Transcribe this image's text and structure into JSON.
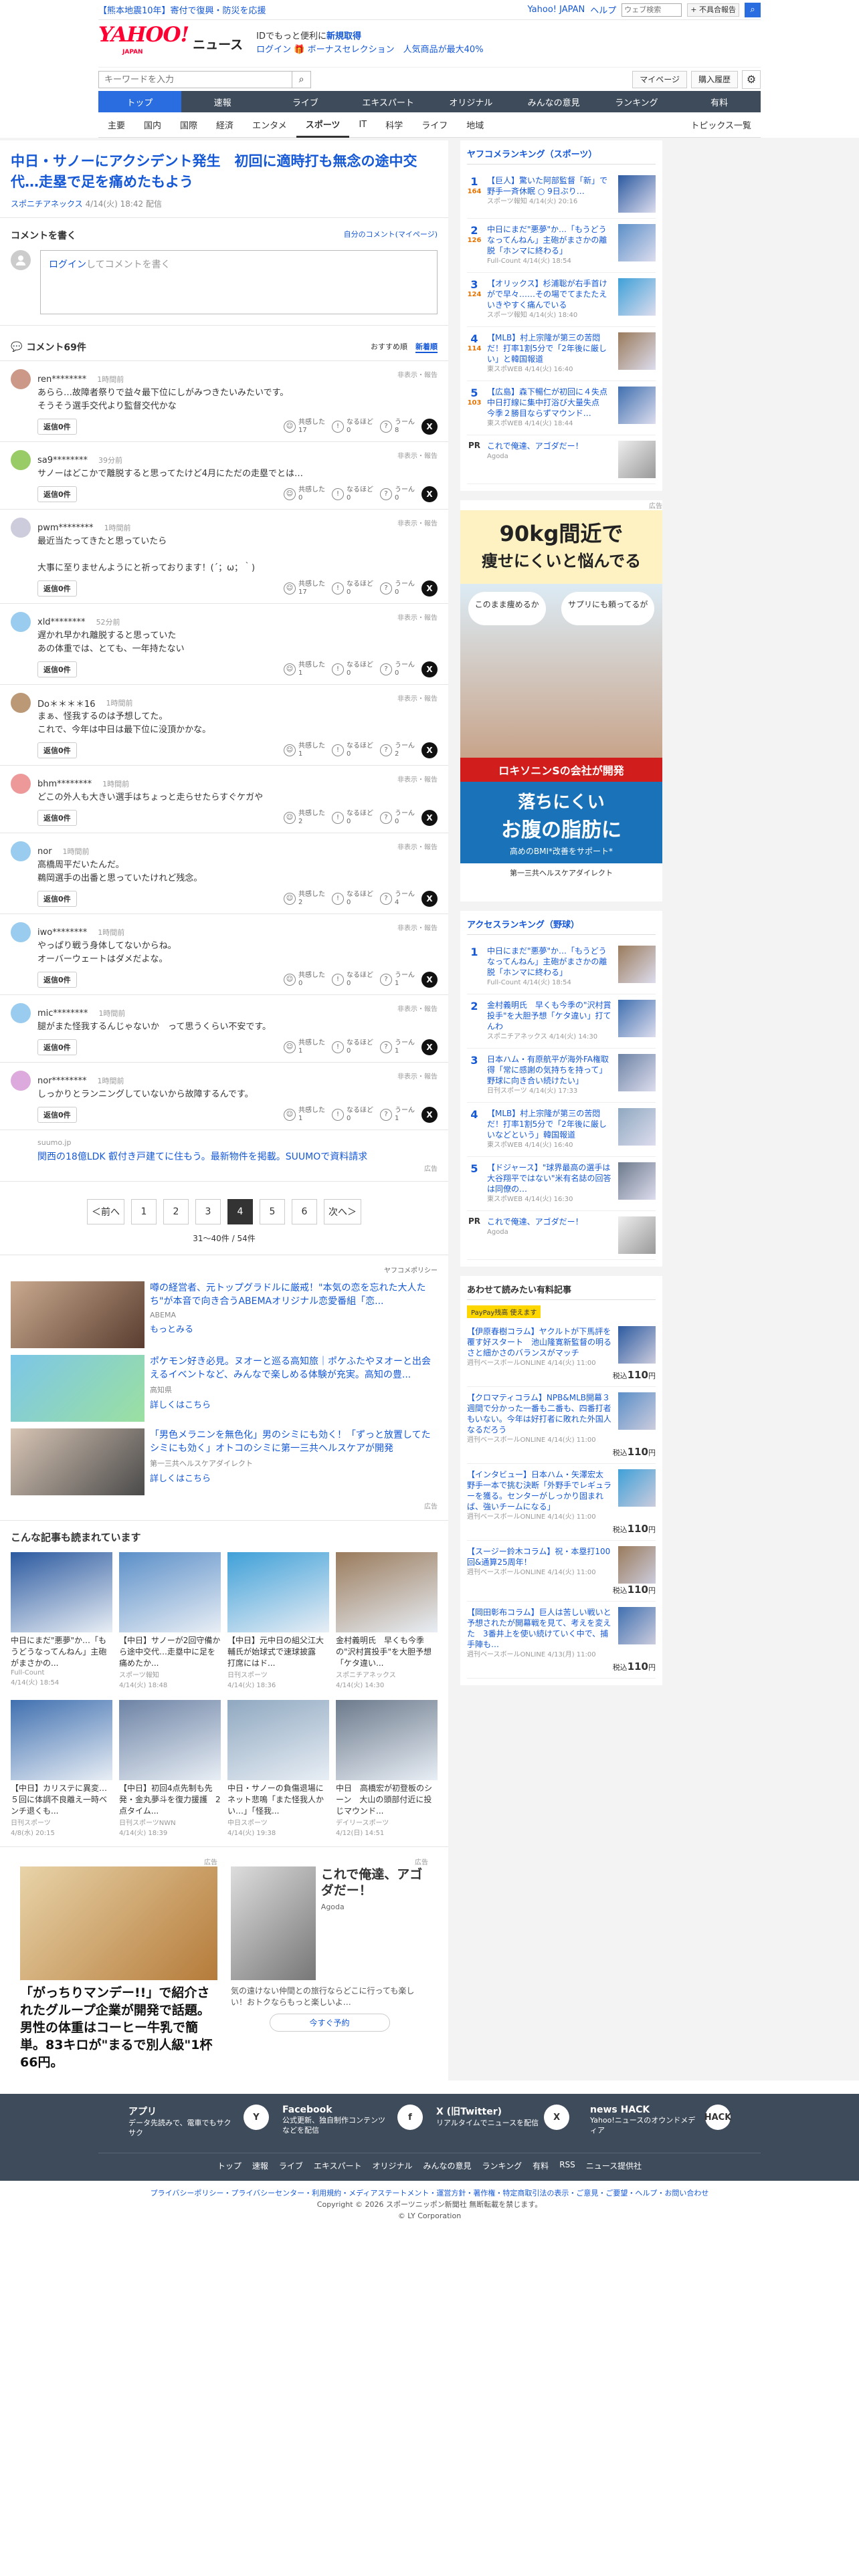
{
  "topbar": {
    "promo": "【熊本地震10年】寄付で復興・防災を応援",
    "links": [
      "Yahoo! JAPAN",
      "ヘルプ"
    ],
    "search_placeholder": "ウェブ検索",
    "request_btn": "+ 不具合報告"
  },
  "header": {
    "logo": "YAHOO!",
    "logo_sub": "JAPAN",
    "section": "ニュース",
    "line1_prefix": "IDでもっと便利に",
    "line1_link": "新規取得",
    "line2_login": "ログイン",
    "line2_rest": "🎁 ボーナスセレクション　人気商品が最大40%"
  },
  "search": {
    "placeholder": "キーワードを入力",
    "mypage": "マイページ",
    "purchase": "購入履歴"
  },
  "mainnav": [
    "トップ",
    "速報",
    "ライブ",
    "エキスパート",
    "オリジナル",
    "みんなの意見",
    "ランキング",
    "有料"
  ],
  "subnav": [
    "主要",
    "国内",
    "国際",
    "経済",
    "エンタメ",
    "スポーツ",
    "IT",
    "科学",
    "ライフ",
    "地域"
  ],
  "subnav_right": "トピックス一覧",
  "article": {
    "title": "中日・サノーにアクシデント発生　初回に適時打も無念の途中交代…走塁で足を痛めたもよう",
    "source": "スポニチアネックス",
    "date": "4/14(火) 18:42 配信"
  },
  "composer": {
    "title": "コメントを書く",
    "mine": "自分のコメント(マイページ)",
    "login": "ログイン",
    "placeholder": "してコメントを書く"
  },
  "comments_head": {
    "title": "コメント69件",
    "sort_recommended": "おすすめ順",
    "sort_new": "新着順"
  },
  "reaction_labels": [
    "共感した",
    "なるほど",
    "うーん"
  ],
  "report_label": "非表示・報告",
  "reply_label": "返信0件",
  "comments": [
    {
      "name": "ren********",
      "time": "1時間前",
      "body": "あらら…故障者祭りで益々最下位にしがみつきたいみたいです。\nそうそう選手交代より監督交代かな",
      "r": [
        "17",
        "0",
        "8"
      ],
      "color": "#c98"
    },
    {
      "name": "sa9********",
      "time": "39分前",
      "body": "サノーはどこかで離脱すると思ってたけど4月にただの走塁でとは…",
      "r": [
        "0",
        "0",
        "0"
      ],
      "color": "#9c6"
    },
    {
      "name": "pwm********",
      "time": "1時間前",
      "body": "最近当たってきたと思っていたら\n\n大事に至りませんようにと祈っております！(´；ω；｀)",
      "r": [
        "17",
        "0",
        "0"
      ],
      "color": "#ccd"
    },
    {
      "name": "xld********",
      "time": "52分前",
      "body": "遅かれ早かれ離脱すると思っていた\nあの体重では、とても、一年持たない",
      "r": [
        "1",
        "0",
        "0"
      ],
      "color": "#9ce"
    },
    {
      "name": "Do＊＊＊＊16",
      "time": "1時間前",
      "body": "まぁ、怪我するのは予想してた。\nこれで、今年は中日は最下位に没頂かかな。",
      "r": [
        "1",
        "0",
        "2"
      ],
      "color": "#b97"
    },
    {
      "name": "bhm********",
      "time": "1時間前",
      "body": "どこの外人も大きい選手はちょっと走らせたらすぐケガや",
      "r": [
        "2",
        "0",
        "0"
      ],
      "color": "#e99"
    },
    {
      "name": "nor",
      "time": "1時間前",
      "body": "高橋周平だいたんだ。\n鵜岡選手の出番と思っていたけれど残念。",
      "r": [
        "2",
        "0",
        "4"
      ],
      "color": "#9ce"
    },
    {
      "name": "iwo********",
      "time": "1時間前",
      "body": "やっぱり戦う身体してないからね。\nオーバーウェートはダメだよな。",
      "r": [
        "0",
        "0",
        "1"
      ],
      "color": "#9ce"
    },
    {
      "name": "mic********",
      "time": "1時間前",
      "body": "腿がまた怪我するんじゃないか　って思うくらい不安です。",
      "r": [
        "1",
        "0",
        "1"
      ],
      "color": "#9ce"
    },
    {
      "name": "nor********",
      "time": "1時間前",
      "body": "しっかりとランニングしていないから故障するんです。",
      "r": [
        "1",
        "0",
        "1"
      ],
      "color": "#dad"
    }
  ],
  "ad_comment": {
    "source": "suumo.jp",
    "title": "関西の18億LDK 叡付き戸建てに住もう。最新物件を掲載。SUUMOで資料請求",
    "label": "広告"
  },
  "pager": {
    "prev": "＜前へ",
    "next": "次へ＞",
    "pages": [
      "1",
      "2",
      "3",
      "4",
      "5",
      "6"
    ],
    "current": "4",
    "count": "31〜40件 / 54件"
  },
  "sponsored": {
    "header": "ヤフコメポリシー",
    "items": [
      {
        "title": "噂の経営者、元トップグラドルに厳戒！\"本気の恋を忘れた大人たち\"が本音で向き合うABEMAオリジナル恋愛番組「恋...",
        "source": "ABEMA",
        "more": "もっとみる"
      },
      {
        "title": "ポケモン好き必見。ヌオーと巡る高知旅｜ポケふたやヌオーと出会えるイベントなど、みんなで楽しめる体験が充実。高知の豊...",
        "source": "高知県",
        "more": "詳しくはこちら"
      },
      {
        "title": "「男色メラニンを無色化」男のシミにも効く！「ずっと放置してたシミにも効く」オトコのシミに第一三共ヘルスケアが開発",
        "source": "第一三共ヘルスケアダイレクト",
        "more": "詳しくはこちら"
      }
    ],
    "footer": "広告"
  },
  "related": {
    "title": "こんな記事も読まれています",
    "items": [
      {
        "title": "中日にまだ\"悪夢\"か…「もうどうなってんねん」主砲がまさかの...",
        "source": "Full-Count",
        "date": "4/14(火) 18:54"
      },
      {
        "title": "【中日】サノーが2回守備から途中交代…走塁中に足を痛めたか...",
        "source": "スポーツ報知",
        "date": "4/14(火) 18:48"
      },
      {
        "title": "【中日】元中日の組父江大輔氏が始球式で速球披露　打席にはド...",
        "source": "日刊スポーツ",
        "date": "4/14(火) 18:36"
      },
      {
        "title": "金村義明氏　早くも今季の\"沢村賞投手\"を大胆予想「ケタ違い...",
        "source": "スポニチアネックス",
        "date": "4/14(火) 14:30"
      },
      {
        "title": "【中日】カリステに異変…５回に体調不良離え一時ベンチ退くも...",
        "source": "日刊スポーツ",
        "date": "4/8(水) 20:15"
      },
      {
        "title": "【中日】初回4点先制も先発・金丸夢斗を復力援護　2点タイム...",
        "source": "日刊スポーツNWN",
        "date": "4/14(火) 18:39"
      },
      {
        "title": "中日・サノーの負傷退場にネット悲鳴「また怪我人かい…」「怪我...",
        "source": "中日スポーツ",
        "date": "4/14(火) 19:38"
      },
      {
        "title": "中日　高橋宏が初登板のシーン　大山の頭部付近に投じマウンド...",
        "source": "デイリースポーツ",
        "date": "4/12(日) 14:51"
      }
    ]
  },
  "bigads": [
    {
      "title": "「がっちりマンデー!!」で紹介されたグループ企業が開発で話題。男性の体重はコーヒー牛乳で簡単。83キロが\"まるで別人級\"1杯66円。",
      "label": "広告"
    },
    {
      "title": "これで俺達、アゴダだー！",
      "source": "Agoda",
      "sub": "気の遠けない仲間との旅行ならどこに行っても楽しい！おトクならもっと楽しいよ…",
      "cta": "今すぐ予約",
      "label": "広告"
    }
  ],
  "sidebar": {
    "rank_title": "ヤフコメランキング（スポーツ）",
    "rank": [
      {
        "n": "1",
        "c": "164",
        "title": "【巨人】驚いた阿部監督「新」で野手一斉休眠 ○ 9日ぶり…",
        "meta": "スポーツ報知 4/14(火) 20:16"
      },
      {
        "n": "2",
        "c": "126",
        "title": "中日にまだ\"悪夢\"か…「もうどうなってんねん」主砲がまさかの離脱「ホンマに終わる」",
        "meta": "Full-Count 4/14(火) 18:54"
      },
      {
        "n": "3",
        "c": "124",
        "title": "【オリックス】杉浦聡が右手首けがで早々……その場でてまたたえいきやすく痛んでいる",
        "meta": "スポーツ報知 4/14(火) 18:40"
      },
      {
        "n": "4",
        "c": "114",
        "title": "【MLB】村上宗隆が第三の苦悶だ！打率1割5分で「2年後に厳しい」と韓国報道",
        "meta": "東スポWEB 4/14(火) 16:40"
      },
      {
        "n": "5",
        "c": "103",
        "title": "【広島】森下暢仁が初回に４失点　中日打線に集中打浴び大量失点　今季２勝目ならずマウンド…",
        "meta": "東スポWEB 4/14(火) 18:44"
      }
    ],
    "rank_pr": {
      "title": "これで俺達、アゴダだー！",
      "source": "Agoda"
    },
    "ad_label": "広告",
    "ad_texts": [
      "90kg間近で",
      "痩せにくいと悩んでる",
      "このまま痩めるか",
      "サプリにも頼ってるが",
      "ロキソニンSの会社が開発",
      "落ちにくい",
      "お腹の脂肪に",
      "高めのBMI*改善をサポート*",
      "第一三共ヘルスケアダイレクト"
    ],
    "access_title": "アクセスランキング（野球）",
    "access": [
      {
        "n": "1",
        "title": "中日にまだ\"悪夢\"か…「もうどうなってんねん」主砲がまさかの離脱「ホンマに終わる」",
        "meta": "Full-Count 4/14(火) 18:54"
      },
      {
        "n": "2",
        "title": "金村義明氏　早くも今季の\"沢村賞投手\"を大胆予想「ケタ違い」打てんわ",
        "meta": "スポニチアネックス 4/14(火) 14:30"
      },
      {
        "n": "3",
        "title": "日本ハム・有原航平が海外FA権取得「常に感謝の気持ちを持って」野球に向き合い続けたい」",
        "meta": "日刊スポーツ 4/14(火) 17:33"
      },
      {
        "n": "4",
        "title": "【MLB】村上宗隆が第三の苦悶だ！打率1割5分で「2年後に厳しいなどという」韓国報道",
        "meta": "東スポWEB 4/14(火) 16:40"
      },
      {
        "n": "5",
        "title": "【ドジャース】\"球界最高の選手は大谷翔平ではない\"米有名誌の回答は同僚の…",
        "meta": "東スポWEB 4/14(火) 16:30"
      }
    ],
    "access_pr": {
      "title": "これで俺達、アゴダだー！",
      "source": "Agoda"
    },
    "magazine_title": "あわせて読みたい有料記事",
    "magazine_badge": "PayPay残高 使えます",
    "magazine": [
      {
        "title": "【伊原春樹コラム】ヤクルトが下馬評を覆す好スタート　池山隆寛新監督の明るさと細かさのバランスがマッチ",
        "source": "週刊ベースボールONLINE 4/14(火) 11:00",
        "price": "110",
        "tax": "税込"
      },
      {
        "title": "【クロマティコラム】NPB&MLB開幕３週間で分かった一番も二番も、四番打者もいない。今年は好打者に敗れた外国人なるだろう",
        "source": "週刊ベースボールONLINE 4/14(火) 11:00",
        "price": "110",
        "tax": "税込"
      },
      {
        "title": "【インタビュー】日本ハム・矢澤宏太　野手一本で挑む決断「外野手でレギュラーを獲る。センターがしっかり固まれば、強いチームになる」",
        "source": "週刊ベースボールONLINE 4/14(火) 11:00",
        "price": "110",
        "tax": "税込"
      },
      {
        "title": "【スージー鈴木コラム】祝・本塁打100回&通算25周年！",
        "source": "週刊ベースボールONLINE 4/14(火) 11:00",
        "price": "110",
        "tax": "税込"
      },
      {
        "title": "【岡田彰布コラム】巨人は苦しい戦いと予想されたが開幕戦を見て、考えを変えた　3番井上を使い続けていく中で、捕手陣も…",
        "source": "週刊ベースボールONLINE 4/13(月) 11:00",
        "price": "110",
        "tax": "税込"
      }
    ]
  },
  "footer": {
    "cols": [
      {
        "title": "アプリ",
        "desc": "データ先読みで、電車でもサクサク",
        "icon": "Y"
      },
      {
        "title": "Facebook",
        "desc": "公式更新、独自制作コンテンツなどを配信",
        "icon": "f"
      },
      {
        "title": "X (旧Twitter)",
        "desc": "リアルタイムでニュースを配信",
        "icon": "X"
      },
      {
        "title": "news HACK",
        "desc": "Yahoo!ニュースのオウンドメディア",
        "icon": "HACK"
      }
    ],
    "links": [
      "トップ",
      "速報",
      "ライブ",
      "エキスパート",
      "オリジナル",
      "みんなの意見",
      "ランキング",
      "有料",
      "RSS",
      "ニュース提供社"
    ],
    "legal_links": "プライバシーポリシー・プライバシーセンター・利用規約・メディアステートメント・運営方針・著作権・特定商取引法の表示・ご意見・ご要望・ヘルプ・お問い合わせ",
    "copyright": "Copyright © 2026 スポーツニッポン新聞社 無断転載を禁じます。",
    "corp": "© LY Corporation"
  }
}
